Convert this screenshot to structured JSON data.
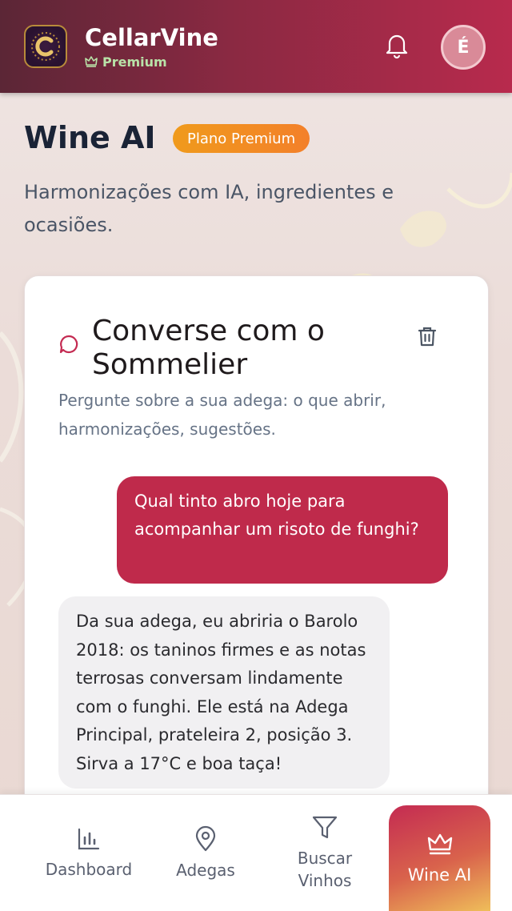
{
  "header": {
    "app_name": "CellarVine",
    "tier": "Premium",
    "avatar_initial": "É"
  },
  "page": {
    "title": "Wine AI",
    "plan_badge": "Plano Premium",
    "subtitle": "Harmonizações com IA, ingredientes e ocasiões."
  },
  "chat": {
    "title": "Converse com o Sommelier",
    "subtitle": "Pergunte sobre a sua adega: o que abrir, harmonizações, sugestões.",
    "messages": [
      {
        "role": "user",
        "text": "Qual tinto abro hoje para acompanhar um risoto de funghi?"
      },
      {
        "role": "assistant",
        "text": "Da sua adega, eu abriria o Barolo 2018: os taninos firmes e as notas terrosas conversam lindamente com o funghi. Ele está na Adega Principal, prateleira 2, posição 3. Sirva a 17°C e boa taça!"
      }
    ]
  },
  "nav": {
    "items": [
      {
        "label": "Dashboard",
        "icon": "bar-chart-icon"
      },
      {
        "label": "Adegas",
        "icon": "map-pin-icon"
      },
      {
        "label": "Buscar Vinhos",
        "icon": "filter-icon"
      },
      {
        "label": "Wine AI",
        "icon": "crown-icon",
        "active": true
      }
    ]
  },
  "colors": {
    "brand": "#b82a4d",
    "user_bubble": "#bf2a4b",
    "badge": "#f09a1c",
    "premium_text": "#b9e3a8"
  }
}
